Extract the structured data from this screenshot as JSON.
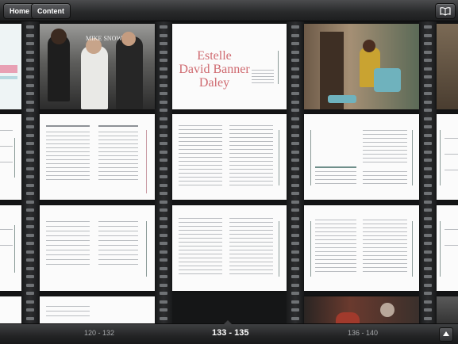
{
  "topbar": {
    "home_label": "Home",
    "content_label": "Content",
    "bookmarks_icon": "open-book-icon"
  },
  "spreads": [
    {
      "name": "Estelle David Banner Daley",
      "title_lines": [
        "Estelle",
        "David Banner",
        "Daley"
      ]
    }
  ],
  "photo_captions": {
    "mike_snow": "MIKE SNOW"
  },
  "bottombar": {
    "prev_range": "120 - 132",
    "current_range": "133 - 135",
    "next_range": "136 - 140",
    "up_icon": "arrow-up-icon"
  },
  "colors": {
    "accent_title": "#cf6a70",
    "page": "#fbfbfb",
    "background": "#151617"
  }
}
